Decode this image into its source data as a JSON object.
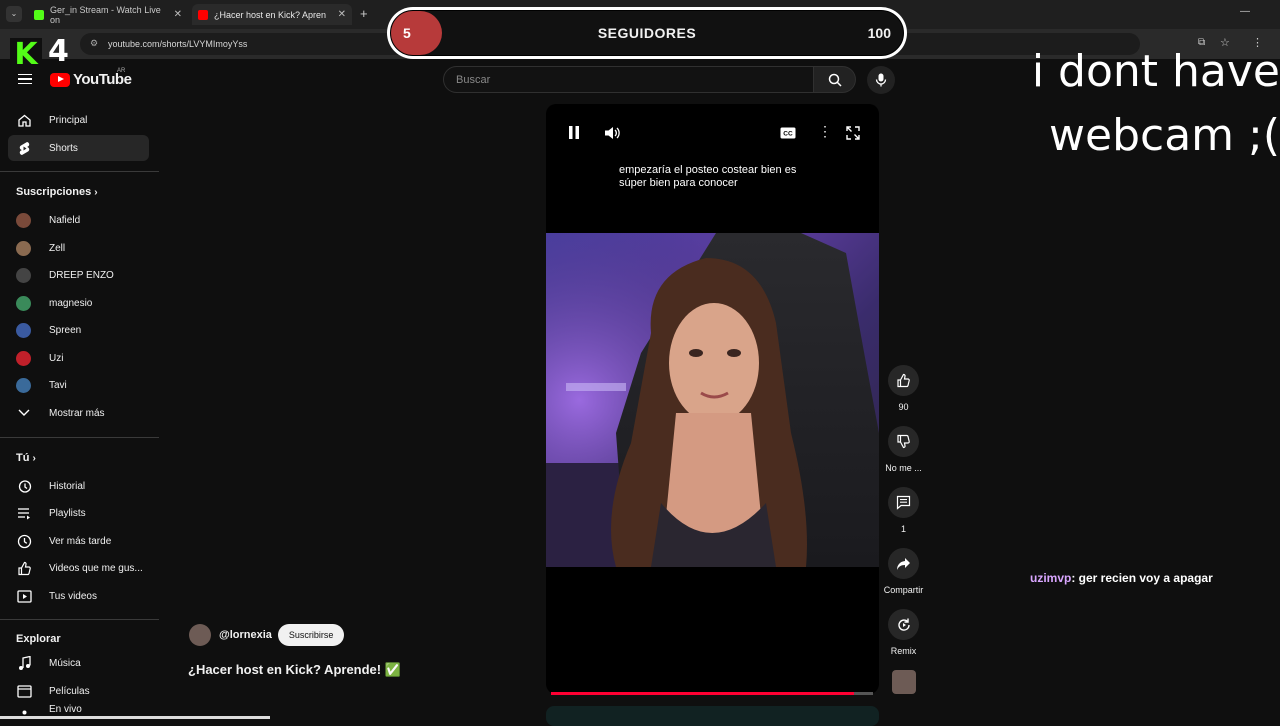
{
  "browser": {
    "tabs": [
      {
        "title": "Ger_in Stream - Watch Live on",
        "active": false
      },
      {
        "title": "¿Hacer host en Kick? Apren",
        "active": true
      }
    ],
    "url": "youtube.com/shorts/LVYMImoyYss"
  },
  "overlay": {
    "kick_logo": "K",
    "kick_count": "4",
    "followers": {
      "current": "5",
      "label": "SEGUIDORES",
      "goal": "100",
      "progress": 0.05
    },
    "webcam_line1": "i dont have",
    "webcam_line2": "webcam ;(",
    "chat": {
      "user": "uzimvp",
      "message": ": ger recien voy a apagar"
    }
  },
  "youtube": {
    "logo_text": "YouTube",
    "country": "AR",
    "search_placeholder": "Buscar",
    "sidebar": {
      "main": [
        {
          "label": "Principal",
          "icon": "home-icon"
        },
        {
          "label": "Shorts",
          "icon": "shorts-icon",
          "active": true
        }
      ],
      "subs_header": "Suscripciones",
      "subs": [
        {
          "label": "Nafield",
          "color": "#7a4a3a"
        },
        {
          "label": "Zell",
          "color": "#8a6a50"
        },
        {
          "label": "DREEP ENZO",
          "color": "#444444"
        },
        {
          "label": "magnesio",
          "color": "#3a8a5a"
        },
        {
          "label": "Spreen",
          "color": "#3a5aa0"
        },
        {
          "label": "Uzi",
          "color": "#c0202a"
        },
        {
          "label": "Tavi",
          "color": "#3a6a9a"
        }
      ],
      "more": "Mostrar más",
      "you_header": "Tú",
      "you": [
        {
          "label": "Historial",
          "icon": "history-icon"
        },
        {
          "label": "Playlists",
          "icon": "playlist-icon"
        },
        {
          "label": "Ver más tarde",
          "icon": "clock-icon"
        },
        {
          "label": "Videos que me gus...",
          "icon": "thumbs-up-icon"
        },
        {
          "label": "Tus videos",
          "icon": "play-square-icon"
        }
      ],
      "explore_header": "Explorar",
      "explore": [
        {
          "label": "Música",
          "icon": "music-icon"
        },
        {
          "label": "Películas",
          "icon": "film-icon"
        },
        {
          "label": "En vivo",
          "icon": "live-icon"
        }
      ]
    },
    "short": {
      "caption": "empezaría el posteo costear bien es súper bien para conocer",
      "progress": 0.94,
      "channel": "@lornexia",
      "subscribe": "Suscribirse",
      "title": "¿Hacer host en Kick? Aprende! ✅",
      "actions": [
        {
          "label": "90",
          "icon": "like-icon"
        },
        {
          "label": "No me ...",
          "icon": "dislike-icon"
        },
        {
          "label": "1",
          "icon": "comment-icon"
        },
        {
          "label": "Compartir",
          "icon": "share-icon"
        },
        {
          "label": "Remix",
          "icon": "remix-icon"
        }
      ]
    }
  }
}
